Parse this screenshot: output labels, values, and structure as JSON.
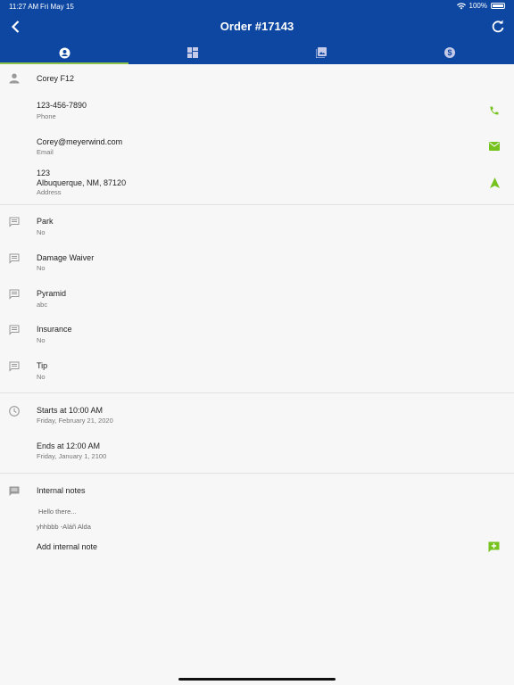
{
  "status_bar": {
    "time": "11:27 AM",
    "date": "Fri May 15",
    "battery": "100%"
  },
  "app_bar": {
    "title": "Order #17143",
    "back_icon": "chevron-left-icon",
    "refresh_icon": "refresh-icon"
  },
  "tabs": [
    {
      "icon": "account-circle-icon",
      "active": true
    },
    {
      "icon": "dashboard-icon",
      "active": false
    },
    {
      "icon": "photo-library-icon",
      "active": false
    },
    {
      "icon": "dollar-icon",
      "active": false
    }
  ],
  "customer": {
    "name": "Corey F12",
    "phone": "123-456-7890",
    "phone_label": "Phone",
    "email": "Corey@meyerwind.com",
    "email_label": "Email",
    "address_line1": "123",
    "address_line2": "Albuquerque, NM, 87120",
    "address_label": "Address"
  },
  "custom_fields": [
    {
      "label": "Park",
      "value": "No"
    },
    {
      "label": "Damage Waiver",
      "value": "No"
    },
    {
      "label": "Pyramid",
      "value": "abc"
    },
    {
      "label": "Insurance",
      "value": "No"
    },
    {
      "label": "Tip",
      "value": "No"
    }
  ],
  "schedule": {
    "starts": "Starts at 10:00 AM",
    "starts_date": "Friday, February 21, 2020",
    "ends": "Ends at 12:00 AM",
    "ends_date": "Friday, January 1, 2100"
  },
  "notes": {
    "title": "Internal notes",
    "note_text": "Hello there...",
    "note_author": "yhhbbb -Aláñ Alda",
    "add_label": "Add internal note"
  },
  "colors": {
    "primary": "#0d47a1",
    "accent": "#76c31f",
    "tab_indicator": "#8bc34a"
  }
}
